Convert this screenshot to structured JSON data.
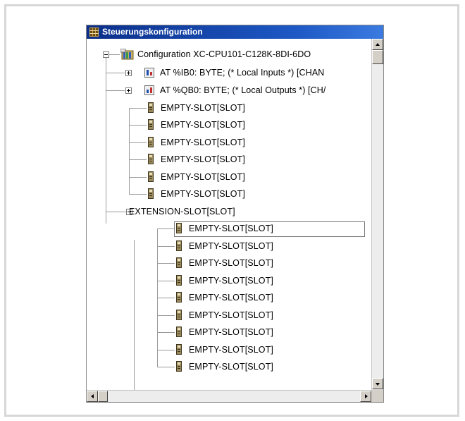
{
  "window": {
    "title": "Steuerungskonfiguration"
  },
  "tree": {
    "root": "Configuration XC-CPU101-C128K-8DI-6DO",
    "inputs": "AT %IB0: BYTE; (* Local Inputs *) [CHAN",
    "outputs": "AT %QB0: BYTE; (* Local Outputs *) [CH/",
    "slots": [
      "EMPTY-SLOT[SLOT]",
      "EMPTY-SLOT[SLOT]",
      "EMPTY-SLOT[SLOT]",
      "EMPTY-SLOT[SLOT]",
      "EMPTY-SLOT[SLOT]",
      "EMPTY-SLOT[SLOT]"
    ],
    "extension": "EXTENSION-SLOT[SLOT]",
    "extension_slots": [
      "EMPTY-SLOT[SLOT]",
      "EMPTY-SLOT[SLOT]",
      "EMPTY-SLOT[SLOT]",
      "EMPTY-SLOT[SLOT]",
      "EMPTY-SLOT[SLOT]",
      "EMPTY-SLOT[SLOT]",
      "EMPTY-SLOT[SLOT]",
      "EMPTY-SLOT[SLOT]",
      "EMPTY-SLOT[SLOT]"
    ]
  },
  "icons": {
    "app": "config-grid-icon",
    "root": "plc-config-icon",
    "inputs": "input-module-icon",
    "outputs": "output-module-icon",
    "slot": "slot-icon"
  },
  "colors": {
    "titlebar_start": "#0b2f8a",
    "titlebar_end": "#3b7be0"
  }
}
